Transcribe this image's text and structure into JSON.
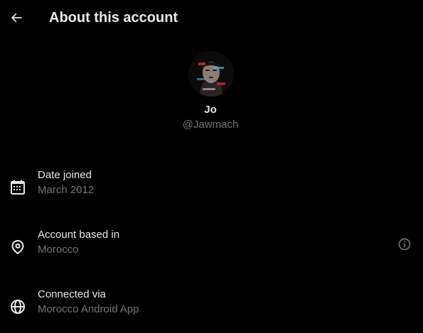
{
  "header": {
    "title": "About this account",
    "back_icon": "arrow-left-icon"
  },
  "profile": {
    "name": "Jo",
    "handle": "@Jawmach",
    "avatar": "glitch-portrait-avatar"
  },
  "details": [
    {
      "icon": "calendar-icon",
      "label": "Date joined",
      "value": "March 2012"
    },
    {
      "icon": "location-pin-icon",
      "label": "Account based in",
      "value": "Morocco",
      "info_icon": "info-circle-icon"
    },
    {
      "icon": "globe-icon",
      "label": "Connected via",
      "value": "Morocco Android App"
    }
  ],
  "colors": {
    "background": "#000000",
    "primary_text": "#e7e9ea",
    "secondary_text": "#71767b"
  }
}
